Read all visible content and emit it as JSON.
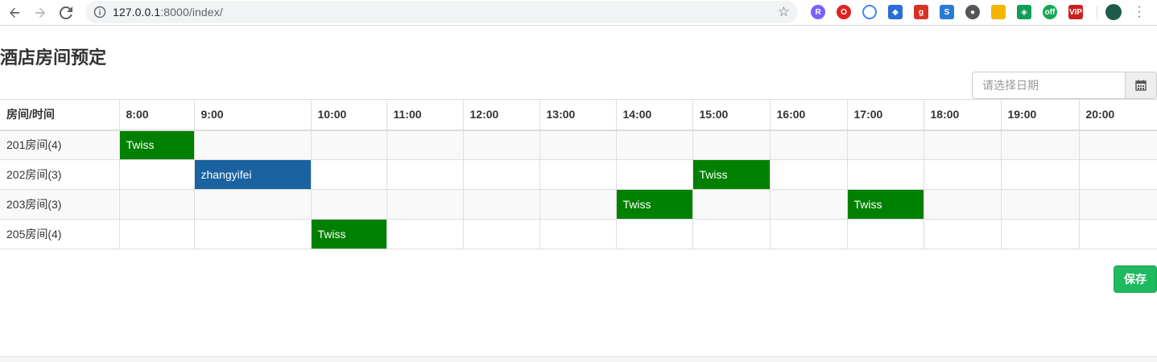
{
  "browser": {
    "url_host": "127.0.0.1",
    "url_rest": ":8000/index/"
  },
  "page": {
    "title": "酒店房间预定",
    "date_placeholder": "请选择日期",
    "save_label": "保存"
  },
  "table": {
    "corner_header": "房间/时间",
    "hours": [
      "8:00",
      "9:00",
      "10:00",
      "11:00",
      "12:00",
      "13:00",
      "14:00",
      "15:00",
      "16:00",
      "17:00",
      "18:00",
      "19:00",
      "20:00"
    ],
    "rooms": [
      {
        "label": "201房间(4)",
        "cells": [
          "Twiss",
          "",
          "",
          "",
          "",
          "",
          "",
          "",
          "",
          "",
          "",
          "",
          ""
        ]
      },
      {
        "label": "202房间(3)",
        "cells": [
          "",
          "zhangyifei",
          "",
          "",
          "",
          "",
          "",
          "Twiss",
          "",
          "",
          "",
          "",
          ""
        ]
      },
      {
        "label": "203房间(3)",
        "cells": [
          "",
          "",
          "",
          "",
          "",
          "",
          "Twiss",
          "",
          "",
          "Twiss",
          "",
          "",
          ""
        ]
      },
      {
        "label": "205房间(4)",
        "cells": [
          "",
          "",
          "Twiss",
          "",
          "",
          "",
          "",
          "",
          "",
          "",
          "",
          "",
          ""
        ]
      }
    ]
  },
  "colors": {
    "booked_other": "#008000",
    "booked_self": "#1a62a0",
    "save_button": "#1fba5f"
  }
}
